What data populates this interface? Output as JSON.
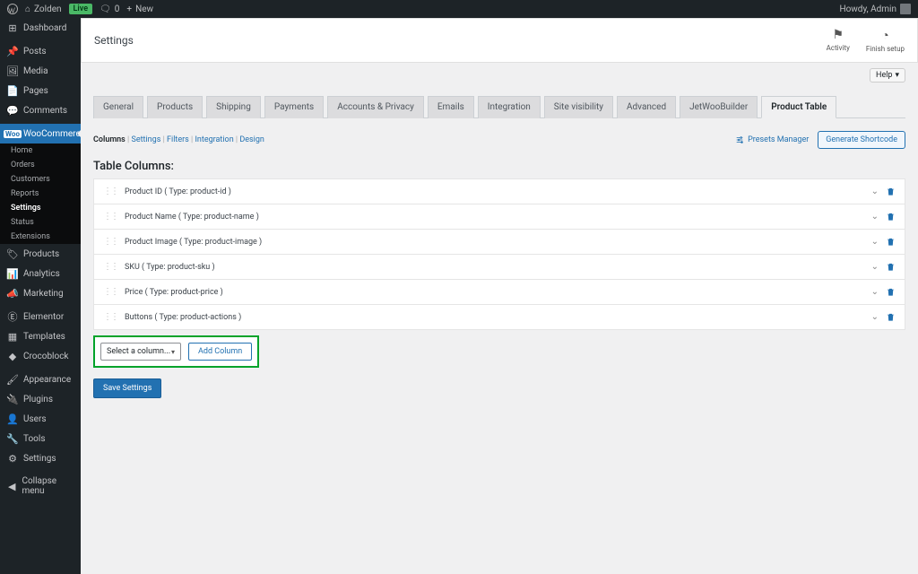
{
  "topbar": {
    "site_name": "Zolden",
    "live": "Live",
    "comment_count": "0",
    "new": "New",
    "howdy": "Howdy, Admin"
  },
  "sidebar": {
    "items": [
      {
        "icon": "dash",
        "label": "Dashboard"
      },
      {
        "sep": true
      },
      {
        "icon": "pin",
        "label": "Posts"
      },
      {
        "icon": "media",
        "label": "Media"
      },
      {
        "icon": "page",
        "label": "Pages"
      },
      {
        "icon": "comment",
        "label": "Comments"
      },
      {
        "sep": true
      },
      {
        "icon": "woo",
        "label": "WooCommerce",
        "active": true,
        "sub": [
          {
            "label": "Home"
          },
          {
            "label": "Orders"
          },
          {
            "label": "Customers"
          },
          {
            "label": "Reports"
          },
          {
            "label": "Settings",
            "active": true
          },
          {
            "label": "Status"
          },
          {
            "label": "Extensions"
          }
        ]
      },
      {
        "icon": "tag",
        "label": "Products"
      },
      {
        "icon": "chart",
        "label": "Analytics"
      },
      {
        "icon": "mega",
        "label": "Marketing"
      },
      {
        "sep": true
      },
      {
        "icon": "elem",
        "label": "Elementor"
      },
      {
        "icon": "tmpl",
        "label": "Templates"
      },
      {
        "icon": "croco",
        "label": "Crocoblock"
      },
      {
        "sep": true
      },
      {
        "icon": "brush",
        "label": "Appearance"
      },
      {
        "icon": "plug",
        "label": "Plugins"
      },
      {
        "icon": "user",
        "label": "Users"
      },
      {
        "icon": "tool",
        "label": "Tools"
      },
      {
        "icon": "cog",
        "label": "Settings"
      },
      {
        "sep": true
      },
      {
        "icon": "collapse",
        "label": "Collapse menu"
      }
    ]
  },
  "page": {
    "title": "Settings",
    "activity": "Activity",
    "finish": "Finish setup",
    "help": "Help"
  },
  "tabs": [
    {
      "label": "General"
    },
    {
      "label": "Products"
    },
    {
      "label": "Shipping"
    },
    {
      "label": "Payments"
    },
    {
      "label": "Accounts & Privacy"
    },
    {
      "label": "Emails"
    },
    {
      "label": "Integration"
    },
    {
      "label": "Site visibility"
    },
    {
      "label": "Advanced"
    },
    {
      "label": "JetWooBuilder"
    },
    {
      "label": "Product Table",
      "active": true
    }
  ],
  "sublinks": {
    "items": [
      {
        "label": "Columns",
        "active": true
      },
      {
        "label": "Settings"
      },
      {
        "label": "Filters"
      },
      {
        "label": "Integration"
      },
      {
        "label": "Design"
      }
    ],
    "presets": "Presets Manager",
    "generate": "Generate Shortcode"
  },
  "columns": {
    "title": "Table Columns:",
    "rows": [
      {
        "label": "Product ID ( Type: product-id )"
      },
      {
        "label": "Product Name ( Type: product-name )"
      },
      {
        "label": "Product Image ( Type: product-image )"
      },
      {
        "label": "SKU ( Type: product-sku )"
      },
      {
        "label": "Price ( Type: product-price )"
      },
      {
        "label": "Buttons ( Type: product-actions )"
      }
    ],
    "select_placeholder": "Select a column...",
    "add": "Add Column",
    "save": "Save Settings"
  },
  "icons": {
    "dash": "◷",
    "pin": "✎",
    "media": "▤",
    "page": "❐",
    "comment": "💬",
    "woo": "W",
    "tag": "⭲",
    "chart": "📊",
    "mega": "📣",
    "elem": "Ⓔ",
    "tmpl": "▦",
    "croco": "◆",
    "brush": "🖌",
    "plug": "🔌",
    "user": "👤",
    "tool": "🔧",
    "cog": "⚙",
    "collapse": "◀"
  }
}
